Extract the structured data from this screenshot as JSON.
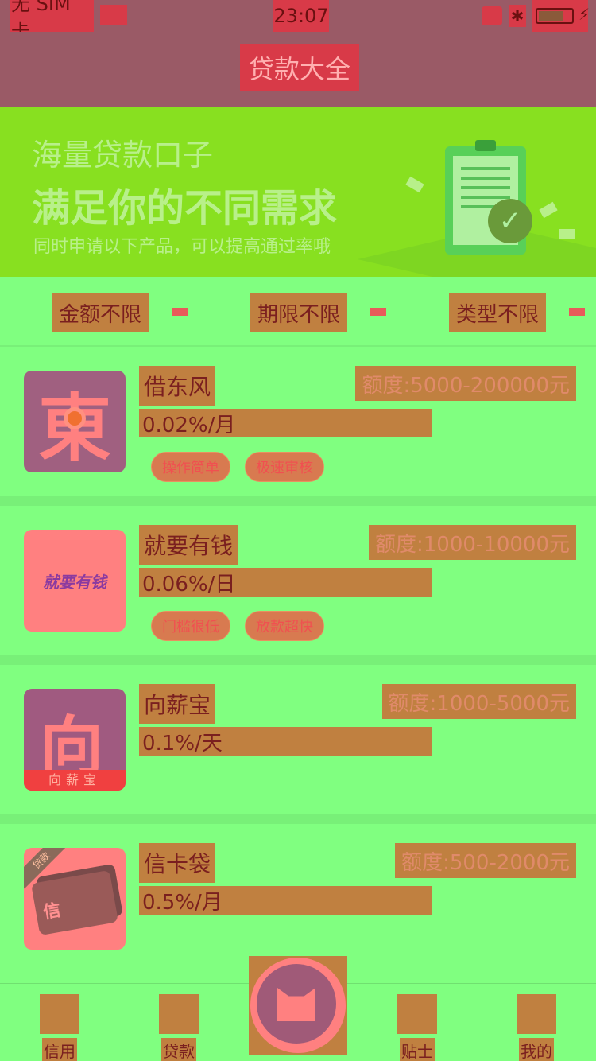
{
  "status_bar": {
    "carrier": "无 SIM 卡",
    "time": "23:07"
  },
  "nav": {
    "title": "贷款大全"
  },
  "banner": {
    "line1": "海量贷款口子",
    "line2": "满足你的不同需求",
    "line3": "同时申请以下产品，可以提高通过率哦"
  },
  "filters": [
    "金额不限",
    "期限不限",
    "类型不限"
  ],
  "products": [
    {
      "name": "借东风",
      "quota": "额度:5000-200000元",
      "rate": "0.02%/月",
      "tags": [
        "操作简单",
        "极速审核"
      ],
      "logo_text": "東"
    },
    {
      "name": "就要有钱",
      "quota": "额度:1000-10000元",
      "rate": "0.06%/日",
      "tags": [
        "门槛很低",
        "放款超快"
      ],
      "logo_text": "就要有钱"
    },
    {
      "name": "向薪宝",
      "quota": "额度:1000-5000元",
      "rate": "0.1%/天",
      "tags": [],
      "logo_text": "向薪宝"
    },
    {
      "name": "信卡袋",
      "quota": "额度:500-2000元",
      "rate": "0.5%/月",
      "tags": [],
      "logo_text": "信",
      "logo_ribbon": "贷款"
    }
  ],
  "tabbar": {
    "items": [
      {
        "label": "信用",
        "icon": "document-icon"
      },
      {
        "label": "贷款",
        "icon": "yuan-icon"
      },
      {
        "label": "",
        "icon": "cat-icon"
      },
      {
        "label": "贴士",
        "icon": "message-icon"
      },
      {
        "label": "我的",
        "icon": "cat-face-icon"
      }
    ]
  },
  "colors": {
    "status_bg": "#9a5a66",
    "banner_bg": "#88e020",
    "page_bg": "#80ff80",
    "accent": "#c08040"
  }
}
